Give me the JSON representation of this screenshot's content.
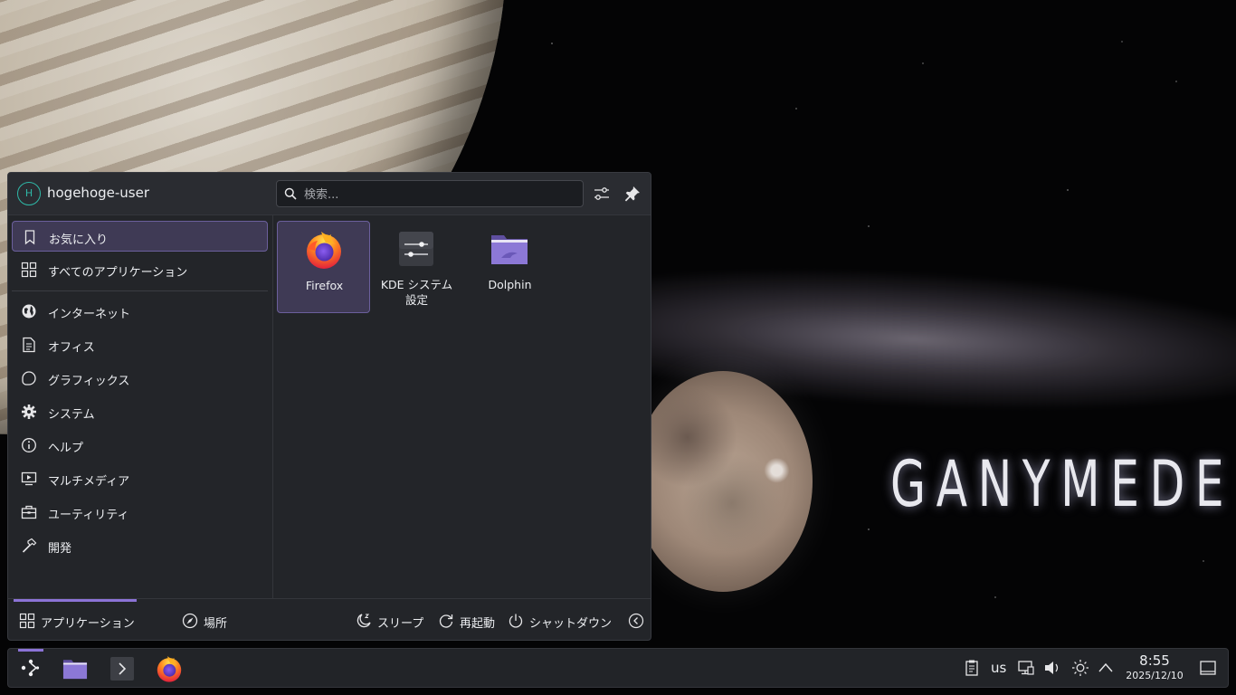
{
  "wallpaper": {
    "title": "GANYMEDE"
  },
  "launcher": {
    "user": {
      "initial": "H",
      "name": "hogehoge-user"
    },
    "search": {
      "placeholder": "検索..."
    },
    "categories": [
      {
        "label": "お気に入り",
        "icon": "bookmark-icon",
        "active": true
      },
      {
        "label": "すべてのアプリケーション",
        "icon": "grid-icon"
      },
      {
        "label": "インターネット",
        "icon": "globe-icon"
      },
      {
        "label": "オフィス",
        "icon": "document-icon"
      },
      {
        "label": "グラフィックス",
        "icon": "graphics-icon"
      },
      {
        "label": "システム",
        "icon": "gear-icon"
      },
      {
        "label": "ヘルプ",
        "icon": "info-icon"
      },
      {
        "label": "マルチメディア",
        "icon": "multimedia-icon"
      },
      {
        "label": "ユーティリティ",
        "icon": "toolbox-icon"
      },
      {
        "label": "開発",
        "icon": "hammer-icon"
      }
    ],
    "apps": [
      {
        "label": "Firefox",
        "icon": "firefox-icon",
        "active": true
      },
      {
        "label": "KDE システム\n設定",
        "icon": "settings-icon"
      },
      {
        "label": "Dolphin",
        "icon": "folder-icon"
      }
    ],
    "footer": {
      "tabs": [
        {
          "label": "アプリケーション",
          "icon": "grid-icon",
          "active": true
        },
        {
          "label": "場所",
          "icon": "compass-icon"
        }
      ],
      "power": [
        {
          "label": "スリープ",
          "icon": "sleep-icon"
        },
        {
          "label": "再起動",
          "icon": "restart-icon"
        },
        {
          "label": "シャットダウン",
          "icon": "power-icon"
        }
      ]
    }
  },
  "taskbar": {
    "keyboard_layout": "us",
    "clock": {
      "time": "8:55",
      "date": "2025/12/10"
    }
  },
  "colors": {
    "accent": "#8b73d6",
    "highlight": "#3f3a55",
    "panel": "#232529"
  }
}
